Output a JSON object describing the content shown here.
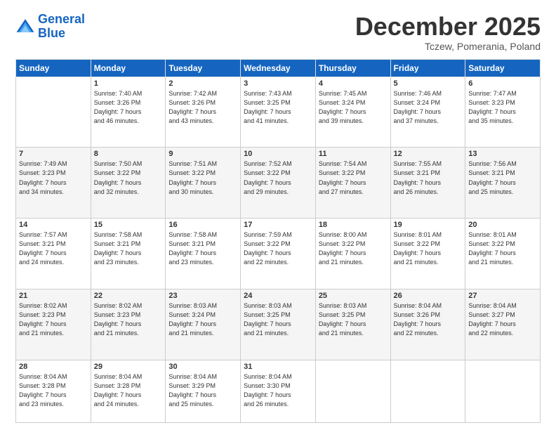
{
  "header": {
    "logo_line1": "General",
    "logo_line2": "Blue",
    "title": "December 2025",
    "location": "Tczew, Pomerania, Poland"
  },
  "weekdays": [
    "Sunday",
    "Monday",
    "Tuesday",
    "Wednesday",
    "Thursday",
    "Friday",
    "Saturday"
  ],
  "weeks": [
    [
      {
        "day": "",
        "info": ""
      },
      {
        "day": "1",
        "info": "Sunrise: 7:40 AM\nSunset: 3:26 PM\nDaylight: 7 hours\nand 46 minutes."
      },
      {
        "day": "2",
        "info": "Sunrise: 7:42 AM\nSunset: 3:26 PM\nDaylight: 7 hours\nand 43 minutes."
      },
      {
        "day": "3",
        "info": "Sunrise: 7:43 AM\nSunset: 3:25 PM\nDaylight: 7 hours\nand 41 minutes."
      },
      {
        "day": "4",
        "info": "Sunrise: 7:45 AM\nSunset: 3:24 PM\nDaylight: 7 hours\nand 39 minutes."
      },
      {
        "day": "5",
        "info": "Sunrise: 7:46 AM\nSunset: 3:24 PM\nDaylight: 7 hours\nand 37 minutes."
      },
      {
        "day": "6",
        "info": "Sunrise: 7:47 AM\nSunset: 3:23 PM\nDaylight: 7 hours\nand 35 minutes."
      }
    ],
    [
      {
        "day": "7",
        "info": "Sunrise: 7:49 AM\nSunset: 3:23 PM\nDaylight: 7 hours\nand 34 minutes."
      },
      {
        "day": "8",
        "info": "Sunrise: 7:50 AM\nSunset: 3:22 PM\nDaylight: 7 hours\nand 32 minutes."
      },
      {
        "day": "9",
        "info": "Sunrise: 7:51 AM\nSunset: 3:22 PM\nDaylight: 7 hours\nand 30 minutes."
      },
      {
        "day": "10",
        "info": "Sunrise: 7:52 AM\nSunset: 3:22 PM\nDaylight: 7 hours\nand 29 minutes."
      },
      {
        "day": "11",
        "info": "Sunrise: 7:54 AM\nSunset: 3:22 PM\nDaylight: 7 hours\nand 27 minutes."
      },
      {
        "day": "12",
        "info": "Sunrise: 7:55 AM\nSunset: 3:21 PM\nDaylight: 7 hours\nand 26 minutes."
      },
      {
        "day": "13",
        "info": "Sunrise: 7:56 AM\nSunset: 3:21 PM\nDaylight: 7 hours\nand 25 minutes."
      }
    ],
    [
      {
        "day": "14",
        "info": "Sunrise: 7:57 AM\nSunset: 3:21 PM\nDaylight: 7 hours\nand 24 minutes."
      },
      {
        "day": "15",
        "info": "Sunrise: 7:58 AM\nSunset: 3:21 PM\nDaylight: 7 hours\nand 23 minutes."
      },
      {
        "day": "16",
        "info": "Sunrise: 7:58 AM\nSunset: 3:21 PM\nDaylight: 7 hours\nand 23 minutes."
      },
      {
        "day": "17",
        "info": "Sunrise: 7:59 AM\nSunset: 3:22 PM\nDaylight: 7 hours\nand 22 minutes."
      },
      {
        "day": "18",
        "info": "Sunrise: 8:00 AM\nSunset: 3:22 PM\nDaylight: 7 hours\nand 21 minutes."
      },
      {
        "day": "19",
        "info": "Sunrise: 8:01 AM\nSunset: 3:22 PM\nDaylight: 7 hours\nand 21 minutes."
      },
      {
        "day": "20",
        "info": "Sunrise: 8:01 AM\nSunset: 3:22 PM\nDaylight: 7 hours\nand 21 minutes."
      }
    ],
    [
      {
        "day": "21",
        "info": "Sunrise: 8:02 AM\nSunset: 3:23 PM\nDaylight: 7 hours\nand 21 minutes."
      },
      {
        "day": "22",
        "info": "Sunrise: 8:02 AM\nSunset: 3:23 PM\nDaylight: 7 hours\nand 21 minutes."
      },
      {
        "day": "23",
        "info": "Sunrise: 8:03 AM\nSunset: 3:24 PM\nDaylight: 7 hours\nand 21 minutes."
      },
      {
        "day": "24",
        "info": "Sunrise: 8:03 AM\nSunset: 3:25 PM\nDaylight: 7 hours\nand 21 minutes."
      },
      {
        "day": "25",
        "info": "Sunrise: 8:03 AM\nSunset: 3:25 PM\nDaylight: 7 hours\nand 21 minutes."
      },
      {
        "day": "26",
        "info": "Sunrise: 8:04 AM\nSunset: 3:26 PM\nDaylight: 7 hours\nand 22 minutes."
      },
      {
        "day": "27",
        "info": "Sunrise: 8:04 AM\nSunset: 3:27 PM\nDaylight: 7 hours\nand 22 minutes."
      }
    ],
    [
      {
        "day": "28",
        "info": "Sunrise: 8:04 AM\nSunset: 3:28 PM\nDaylight: 7 hours\nand 23 minutes."
      },
      {
        "day": "29",
        "info": "Sunrise: 8:04 AM\nSunset: 3:28 PM\nDaylight: 7 hours\nand 24 minutes."
      },
      {
        "day": "30",
        "info": "Sunrise: 8:04 AM\nSunset: 3:29 PM\nDaylight: 7 hours\nand 25 minutes."
      },
      {
        "day": "31",
        "info": "Sunrise: 8:04 AM\nSunset: 3:30 PM\nDaylight: 7 hours\nand 26 minutes."
      },
      {
        "day": "",
        "info": ""
      },
      {
        "day": "",
        "info": ""
      },
      {
        "day": "",
        "info": ""
      }
    ]
  ]
}
